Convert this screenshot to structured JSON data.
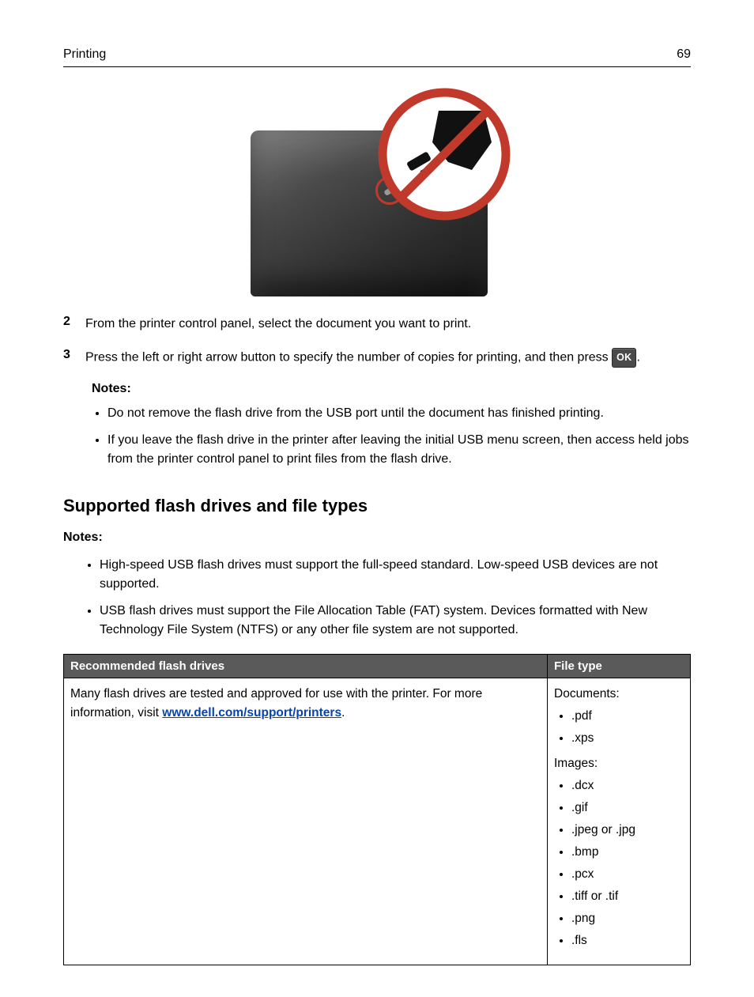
{
  "header": {
    "section": "Printing",
    "page_number": "69"
  },
  "steps": {
    "s2": {
      "num": "2",
      "text": "From the printer control panel, select the document you want to print."
    },
    "s3": {
      "num": "3",
      "prefix": "Press the left or right arrow button to specify the number of copies for printing, and then press ",
      "ok_label": "OK",
      "suffix": "."
    }
  },
  "steps_notes": {
    "title": "Notes:",
    "items": [
      "Do not remove the flash drive from the USB port until the document has finished printing.",
      "If you leave the flash drive in the printer after leaving the initial USB menu screen, then access held jobs from the printer control panel to print files from the flash drive."
    ]
  },
  "section_heading": "Supported flash drives and file types",
  "section_notes": {
    "title": "Notes:",
    "items": [
      "High-speed USB flash drives must support the full-speed standard. Low-speed USB devices are not supported.",
      "USB flash drives must support the File Allocation Table (FAT) system. Devices formatted with New Technology File System (NTFS) or any other file system are not supported."
    ]
  },
  "table": {
    "headers": {
      "drives": "Recommended flash drives",
      "filetype": "File type"
    },
    "drives_cell": {
      "text": "Many flash drives are tested and approved for use with the printer. For more information, visit ",
      "link_text": "www.dell.com/support/printers",
      "tail": "."
    },
    "filetype_cell": {
      "documents_label": "Documents:",
      "documents": [
        ".pdf",
        ".xps"
      ],
      "images_label": "Images:",
      "images": [
        ".dcx",
        ".gif",
        ".jpeg or .jpg",
        ".bmp",
        ".pcx",
        ".tiff or .tif",
        ".png",
        ".fls"
      ]
    }
  }
}
